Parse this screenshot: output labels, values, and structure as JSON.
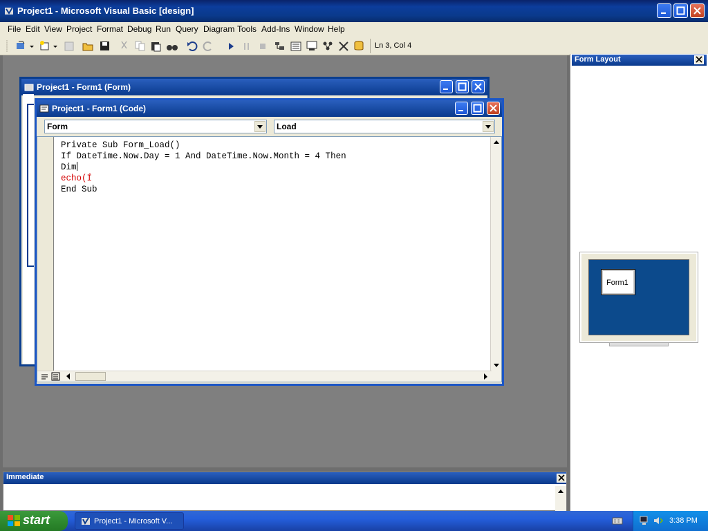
{
  "app": {
    "title": "Project1 - Microsoft Visual Basic [design]"
  },
  "menu": [
    "File",
    "Edit",
    "View",
    "Project",
    "Format",
    "Debug",
    "Run",
    "Query",
    "Diagram",
    "Tools",
    "Add-Ins",
    "Window",
    "Help"
  ],
  "toolbar": {
    "cursor_position": "Ln 3, Col 4"
  },
  "form_window": {
    "title": "Project1 - Form1 (Form)"
  },
  "code_window": {
    "title": "Project1 - Form1 (Code)",
    "object_combo": "Form",
    "procedure_combo": "Load",
    "lines": [
      {
        "text": "Private Sub Form_Load()",
        "color": "#000000"
      },
      {
        "text": "If DateTime.Now.Day = 1 And DateTime.Now.Month = 4 Then",
        "color": "#000000"
      },
      {
        "text": "Dim",
        "color": "#000000"
      },
      {
        "text": "echo(Í",
        "color": "#d40000"
      },
      {
        "text": "End Sub",
        "color": "#000000"
      }
    ]
  },
  "form_layout": {
    "title": "Form Layout",
    "form_label": "Form1"
  },
  "immediate": {
    "title": "Immediate"
  },
  "taskbar": {
    "start_label": "start",
    "task_label": "Project1 - Microsoft V...",
    "clock": "3:38 PM"
  },
  "colors": {
    "accent": "#0a3a8c",
    "error_text": "#d40000",
    "desktop": "#7f7f7f"
  }
}
